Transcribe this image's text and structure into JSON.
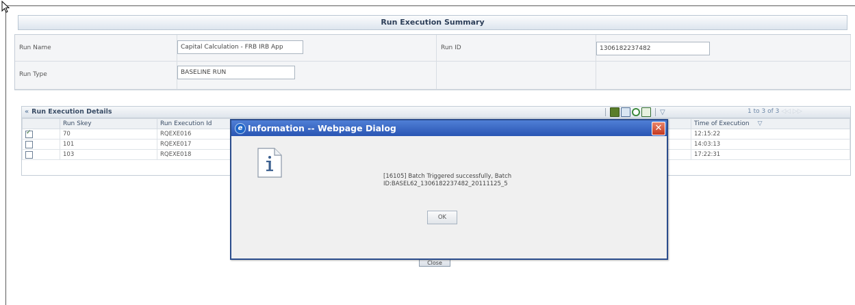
{
  "page": {
    "title": "Run Execution Summary"
  },
  "run_info": {
    "run_name_label": "Run Name",
    "run_name_value": "Capital Calculation - FRB IRB App",
    "run_id_label": "Run ID",
    "run_id_value": "1306182237482",
    "run_type_label": "Run Type",
    "run_type_value": "BASELINE RUN"
  },
  "grid": {
    "title": "Run Execution Details",
    "collapse_icon": "double-chevron-up-icon",
    "toolbar_icons": [
      "view-icon",
      "calendar-icon",
      "link-icon",
      "export-icon",
      "filter-icon"
    ],
    "pager": "1 to 3 of 3",
    "columns": [
      "",
      "Run Skey",
      "Run Execution Id",
      "Time of Execution"
    ],
    "rows": [
      {
        "checked": true,
        "skey": "70",
        "exec_id": "RQEXE016",
        "time": "12:15:22"
      },
      {
        "checked": false,
        "skey": "101",
        "exec_id": "RQEXE017",
        "time": "14:03:13"
      },
      {
        "checked": false,
        "skey": "103",
        "exec_id": "RQEXE018",
        "time": "17:22:31"
      }
    ]
  },
  "close_button": "Close",
  "dialog": {
    "title": "Information -- Webpage Dialog",
    "message": "[16105] Batch Triggered successfully, Batch ID:BASEL62_1306182237482_20111125_5",
    "ok_label": "OK",
    "icon": "information-icon"
  },
  "colors": {
    "dialog_title_bar": "#2a55b3",
    "dialog_close": "#c5371f",
    "header_text": "#2c3e58"
  }
}
